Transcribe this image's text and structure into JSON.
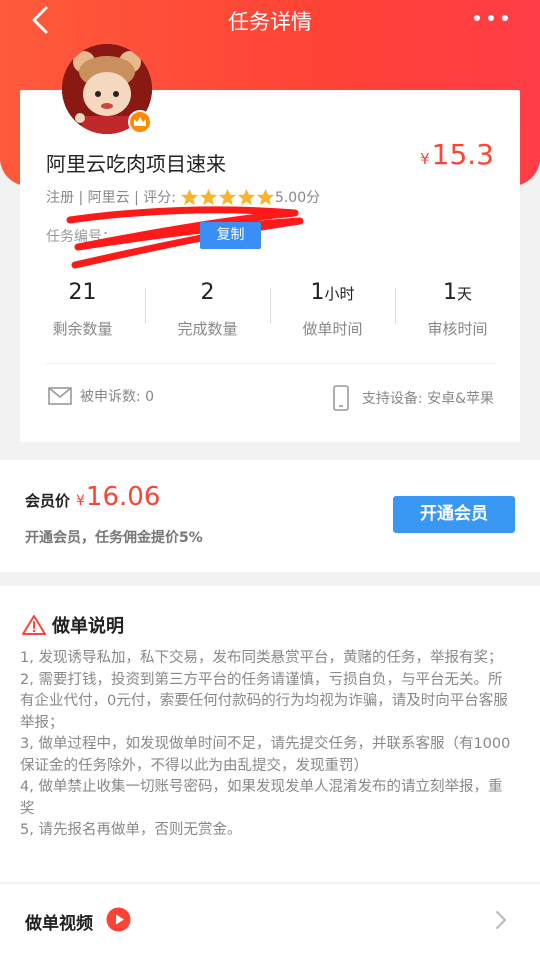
{
  "nav": {
    "title": "任务详情"
  },
  "task": {
    "title": "阿里云吃肉项目速来",
    "price_symbol": "¥",
    "price": "15.3",
    "meta_prefix": "注册 | 阿里云 | 评分:",
    "rating": "5.00分",
    "stars": 5,
    "task_no_label": "任务编号：",
    "copy_label": "复制"
  },
  "stats": [
    {
      "value": "21",
      "unit": "",
      "label": "剩余数量"
    },
    {
      "value": "2",
      "unit": "",
      "label": "完成数量"
    },
    {
      "value": "1",
      "unit": "小时",
      "label": "做单时间"
    },
    {
      "value": "1",
      "unit": "天",
      "label": "审核时间"
    }
  ],
  "complaint": {
    "label": "被申诉数: 0"
  },
  "device": {
    "label": "支持设备: 安卓&苹果"
  },
  "member": {
    "label": "会员价",
    "price_symbol": "¥",
    "price": "16.06",
    "sub": "开通会员，任务佣金提价5%",
    "button": "开通会员"
  },
  "instructions": {
    "title": "做单说明",
    "items": [
      "1, 发现诱导私加，私下交易，发布同类悬赏平台，黄赌的任务，举报有奖；",
      "2, 需要打钱，投资到第三方平台的任务请谨慎，亏损自负，与平台无关。所有企业代付，0元付，索要任何付款码的行为均视为诈骗，请及时向平台客服举报；",
      "3, 做单过程中，如发现做单时间不足，请先提交任务，并联系客服（有1000保证金的任务除外，不得以此为由乱提交，发现重罚）",
      "4, 做单禁止收集一切账号密码，如果发现发单人混淆发布的请立刻举报，重奖",
      "5, 请先报名再做单，否则无赏金。"
    ]
  },
  "video": {
    "title": "做单视频"
  },
  "colors": {
    "primary_red": "#ff4236",
    "primary_blue": "#3a8ef5",
    "star": "#f7b52c"
  }
}
